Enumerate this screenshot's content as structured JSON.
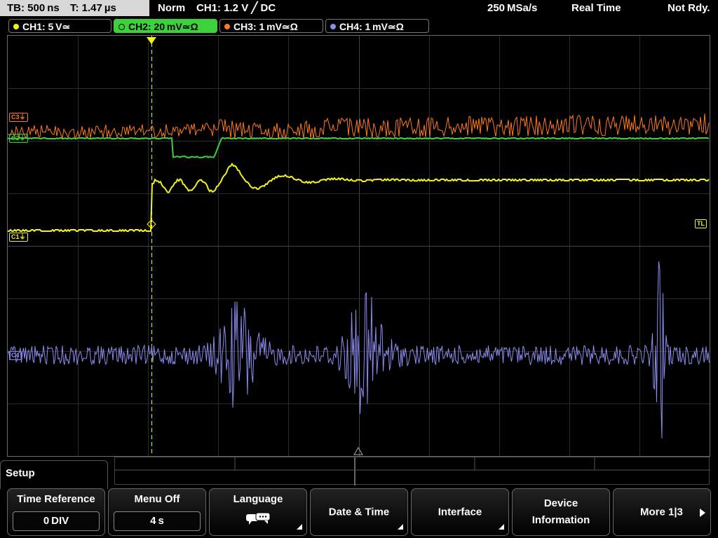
{
  "status_bar": {
    "timebase": "TB: 500 ns",
    "trigger_time": "T: 1.47 µs",
    "mode": "Norm",
    "trigger": "CH1: 1.2 V ╱ DC",
    "sample_rate": "250 MSa/s",
    "acq_mode": "Real Time",
    "state": "Not Rdy."
  },
  "channels": [
    {
      "label": "CH1: 5 V≃",
      "color": "#f2f21c"
    },
    {
      "label": "CH2: 20 mV≃Ω",
      "color": "#3cd23c"
    },
    {
      "label": "CH3: 1 mV≃Ω",
      "color": "#ff7a1e"
    },
    {
      "label": "CH4: 1 mV≃Ω",
      "color": "#8c8cf0"
    }
  ],
  "markers": {
    "c3": "C3⏚",
    "c2": "C2⏚",
    "c1": "C1⏚",
    "c4": "C4",
    "tl": "TL"
  },
  "menu": {
    "title": "Setup",
    "softkeys": [
      {
        "label": "Time Reference",
        "value": "0 DIV"
      },
      {
        "label": "Menu Off",
        "value": "4 s"
      },
      {
        "label": "Language",
        "icon": "speech-bubble-icon"
      },
      {
        "label": "Date & Time"
      },
      {
        "label": "Interface"
      },
      {
        "label": "Device Information"
      },
      {
        "label": "More 1|3"
      }
    ]
  }
}
